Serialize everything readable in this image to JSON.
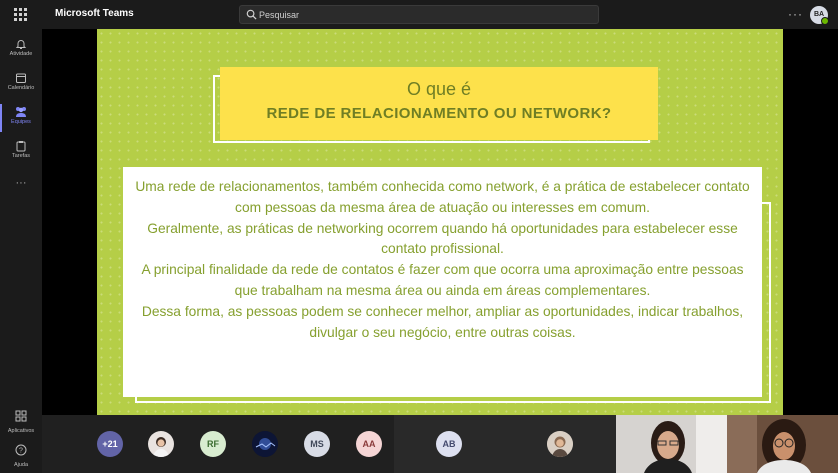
{
  "app": {
    "title": "Microsoft Teams"
  },
  "search": {
    "placeholder": "Pesquisar"
  },
  "account": {
    "initials": "BA",
    "status_color": "#6bb700"
  },
  "rail": {
    "items": [
      {
        "label": "Atividade",
        "icon": "bell-icon"
      },
      {
        "label": "Calendário",
        "icon": "calendar-icon"
      },
      {
        "label": "Equipes",
        "icon": "teams-icon",
        "active": true
      },
      {
        "label": "Tarefas",
        "icon": "clipboard-icon"
      }
    ],
    "more": "···",
    "bottom": [
      {
        "label": "Aplicativos",
        "icon": "apps-icon"
      },
      {
        "label": "Ajuda",
        "icon": "help-icon"
      }
    ]
  },
  "slide": {
    "title_line1": "O que é",
    "title_line2": "REDE DE RELACIONAMENTO OU NETWORK?",
    "paragraphs": [
      "Uma rede de relacionamentos, também conhecida como network, é a prática de estabelecer contato com pessoas da mesma área de atuação ou interesses em comum.",
      "Geralmente, as práticas de networking ocorrem quando há oportunidades para estabelecer esse contato profissional.",
      "A principal finalidade da rede de contatos é fazer com que ocorra uma aproximação entre pessoas que trabalham na mesma área ou ainda em áreas complementares.",
      "Dessa forma, as pessoas podem se conhecer melhor, ampliar as oportunidades, indicar trabalhos, divulgar o seu negócio, entre outras coisas."
    ],
    "colors": {
      "background": "#b5ce47",
      "title_box": "#fde14b",
      "text": "#86a02f"
    }
  },
  "participants": {
    "overflow": "+21",
    "avatars": [
      {
        "initials": "RF",
        "color": "#d8ecd0",
        "text_color": "#3a6b2f"
      },
      {
        "initials": "MS",
        "color": "#d8dce6",
        "text_color": "#40485a"
      },
      {
        "initials": "AA",
        "color": "#f5d5d5",
        "text_color": "#8a3b3b"
      },
      {
        "initials": "AB",
        "color": "#dde0f0",
        "text_color": "#444a6e"
      }
    ]
  }
}
